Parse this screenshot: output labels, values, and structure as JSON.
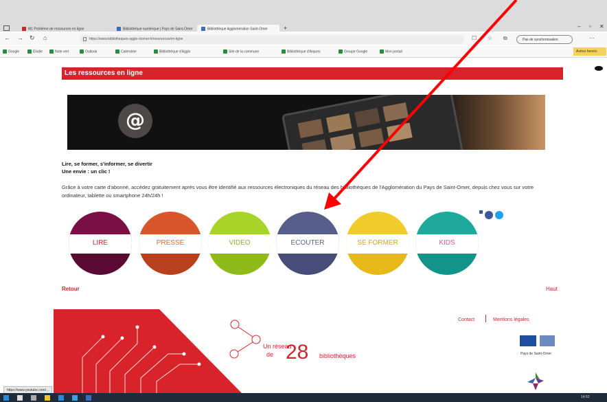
{
  "browser": {
    "tabs": [
      {
        "label": "M1 Problème de ressources en ligne"
      },
      {
        "label": "Bibliothèque numérique | Pays de Saint-Omer"
      },
      {
        "label": "Bibliothèque Agglomération Saint-Omer"
      }
    ],
    "new_tab": "+",
    "url": "https://www.bibliotheques-agglo-stomer.fr/ressources/en-ligne",
    "sync_button": "Pas de synchronisation",
    "bookmarks": [
      {
        "label": "Google"
      },
      {
        "label": "Élodie"
      },
      {
        "label": "Note vert"
      },
      {
        "label": "Outlook"
      },
      {
        "label": "Calendrier"
      },
      {
        "label": "Bibliothèque d'Agglo"
      },
      {
        "label": "Site de la commune"
      },
      {
        "label": "Bibliothèque d'Arques"
      },
      {
        "label": "Groupe Google"
      },
      {
        "label": "Mon portail"
      }
    ],
    "other_favorites": "Autres favoris"
  },
  "page": {
    "section_title": "Les ressources en ligne",
    "banner_symbol": "@",
    "intro_line1": "Lire, se former, s'informer, se divertir",
    "intro_line2": "Une envie : un clic !",
    "paragraph": "Grâce à votre carte d'abonné, accédez gratuitement après vous être identifié aux ressources électroniques du réseau des bibliothèques de l'Agglomération du Pays de Saint-Omer, depuis chez vous sur votre ordinateur, tablette ou smartphone 24h/24h !",
    "categories": [
      {
        "label": "LIRE",
        "top": "#7a0f45",
        "bottom": "#5a0a33",
        "text": "#d8232a"
      },
      {
        "label": "PRESSE",
        "top": "#d9562a",
        "bottom": "#b8401c",
        "text": "#e06a2b"
      },
      {
        "label": "VIDEO",
        "top": "#a8d42a",
        "bottom": "#8fbb1a",
        "text": "#8ab830"
      },
      {
        "label": "ECOUTER",
        "top": "#585e8c",
        "bottom": "#474c78",
        "text": "#585e8c"
      },
      {
        "label": "SE FORMER",
        "top": "#f0cc2a",
        "bottom": "#e6b918",
        "text": "#d6a91a"
      },
      {
        "label": "KIDS",
        "top": "#1fa89c",
        "bottom": "#14938a",
        "text": "#e8559a"
      }
    ],
    "retour": "Retour",
    "haut": "Haut"
  },
  "footer": {
    "reseau_prefix": "Un réseau",
    "reseau_de": "de",
    "reseau_number": "28",
    "reseau_suffix": "bibliothèques",
    "contact": "Contact",
    "mentions": "Mentions légales",
    "pays_label": "Pays de Saint-Omer"
  },
  "status_bar": {
    "url": "https://www.youtube.com/..."
  },
  "taskbar": {
    "clock": "14:52"
  },
  "colors": {
    "brand_red": "#d8232a",
    "annotation_arrow": "#ff0000"
  }
}
